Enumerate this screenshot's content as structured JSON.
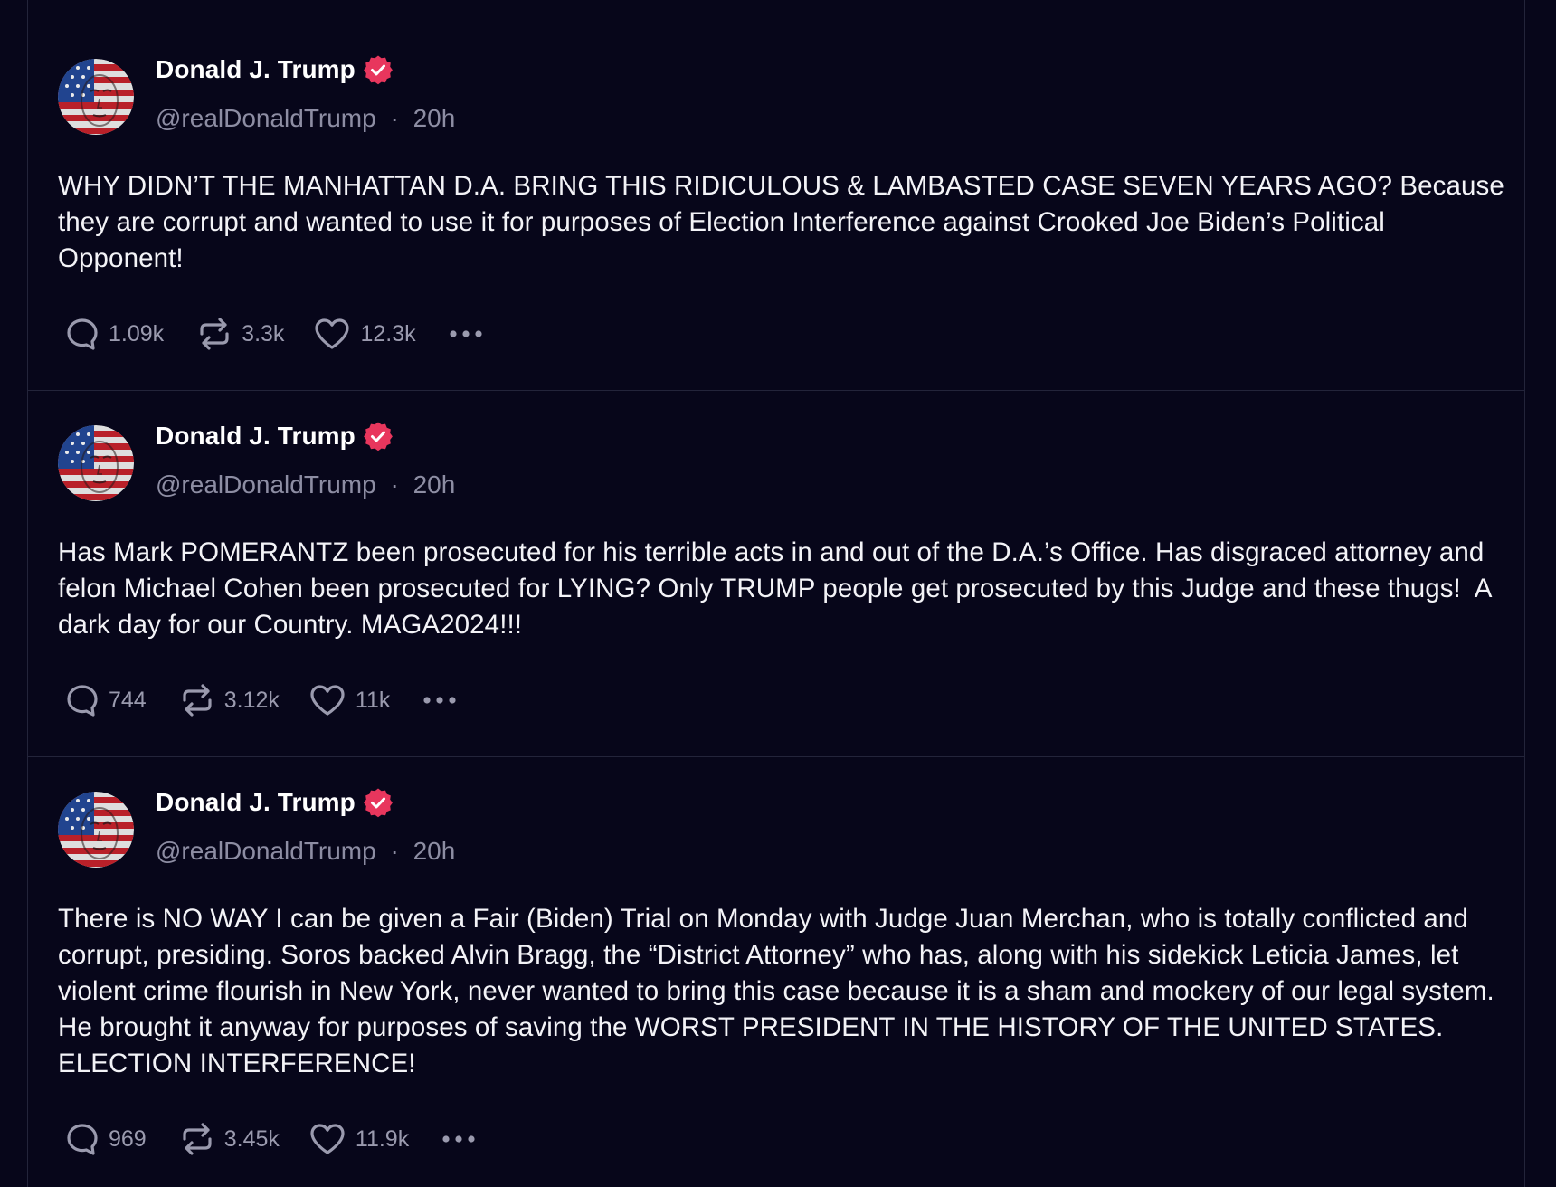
{
  "colors": {
    "background": "#07061a",
    "divider": "#23243a",
    "text_primary": "#f3f3f7",
    "text_secondary": "#8d8da3",
    "verified_badge": "#e8365d"
  },
  "posts": [
    {
      "author": {
        "name": "Donald J. Trump",
        "handle": "@realDonaldTrump",
        "verified": true,
        "avatar_icon": "avatar-flag-portrait"
      },
      "separator": "·",
      "time": "20h",
      "text": "WHY DIDN’T THE MANHATTAN D.A. BRING THIS RIDICULOUS & LAMBASTED CASE SEVEN YEARS AGO? Because they are corrupt and wanted to use it for purposes of Election Interference against Crooked Joe Biden’s Political Opponent!",
      "stats": {
        "replies": "1.09k",
        "reposts": "3.3k",
        "likes": "12.3k"
      }
    },
    {
      "author": {
        "name": "Donald J. Trump",
        "handle": "@realDonaldTrump",
        "verified": true,
        "avatar_icon": "avatar-flag-portrait"
      },
      "separator": "·",
      "time": "20h",
      "text": "Has Mark POMERANTZ been prosecuted for his terrible acts in and out of the D.A.’s Office. Has disgraced attorney and felon Michael Cohen been prosecuted for LYING? Only TRUMP people get prosecuted by this Judge and these thugs!  A dark day for our Country. MAGA2024!!!",
      "stats": {
        "replies": "744",
        "reposts": "3.12k",
        "likes": "11k"
      }
    },
    {
      "author": {
        "name": "Donald J. Trump",
        "handle": "@realDonaldTrump",
        "verified": true,
        "avatar_icon": "avatar-flag-portrait"
      },
      "separator": "·",
      "time": "20h",
      "text": "There is NO WAY I can be given a Fair (Biden) Trial on Monday with Judge Juan Merchan, who is totally conflicted and corrupt, presiding. Soros backed Alvin Bragg, the “District Attorney” who has, along with his sidekick Leticia James, let violent crime flourish in New York, never wanted to bring this case because it is a sham and mockery of our legal system. He brought it anyway for purposes of saving the WORST PRESIDENT IN THE HISTORY OF THE UNITED STATES. ELECTION INTERFERENCE!",
      "stats": {
        "replies": "969",
        "reposts": "3.45k",
        "likes": "11.9k"
      }
    }
  ]
}
